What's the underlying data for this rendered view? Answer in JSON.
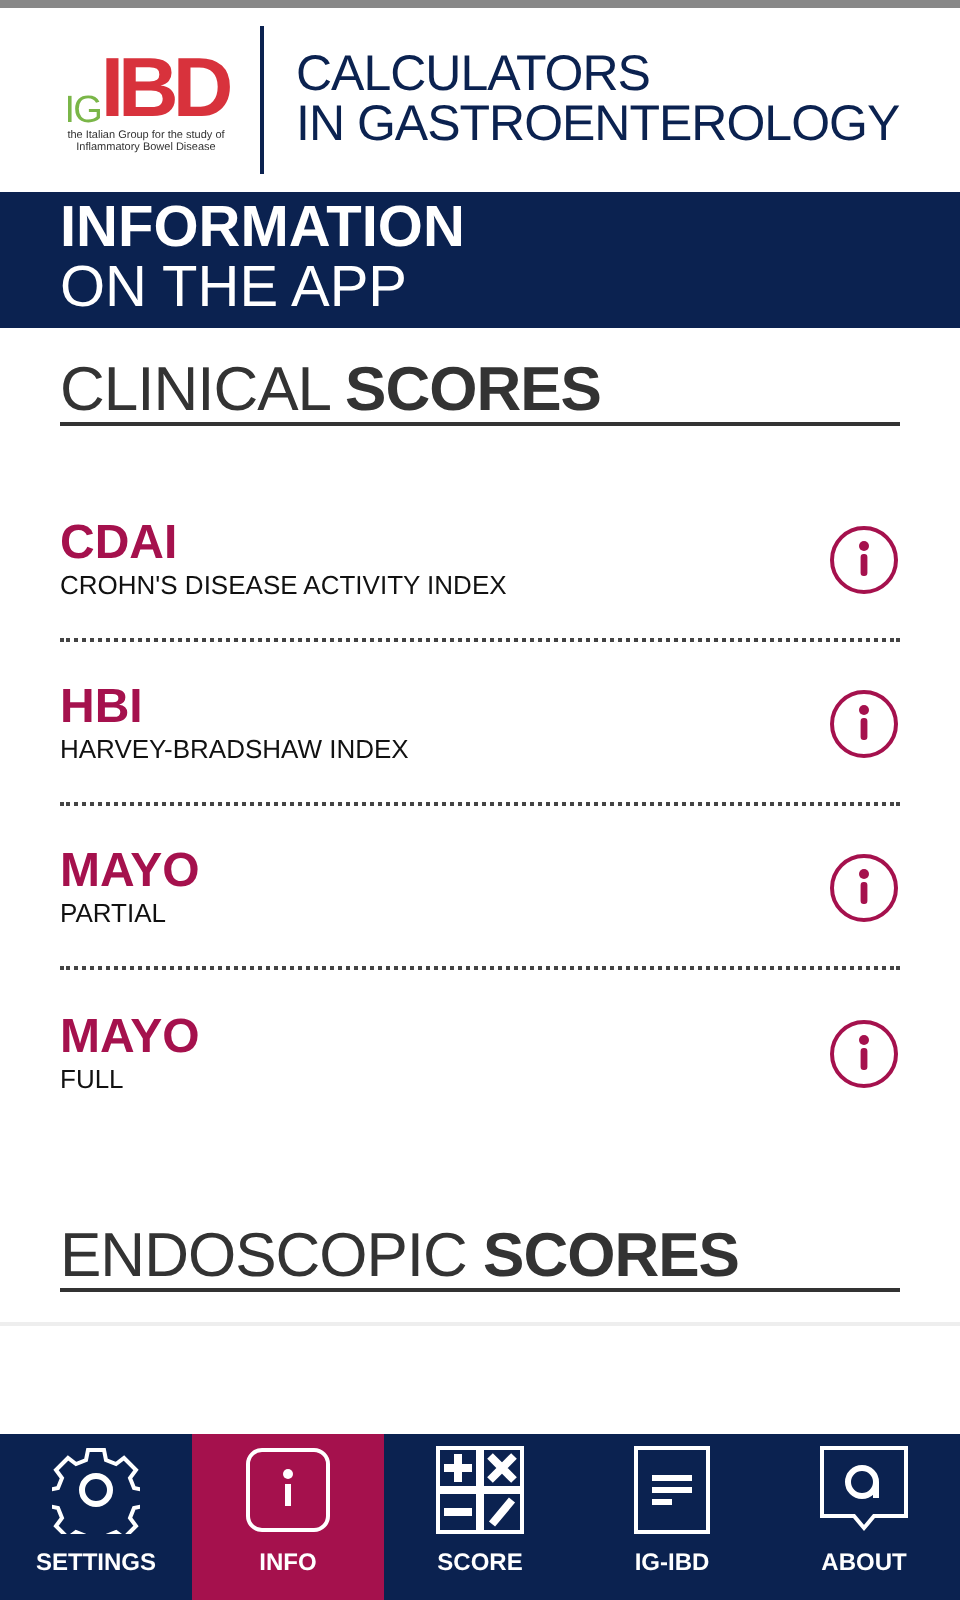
{
  "header": {
    "logo": {
      "prefix": "IG",
      "main": "IBD",
      "tagline": [
        "the Italian Group for the study of",
        "Inflammatory Bowel Disease"
      ]
    },
    "title": [
      "CALCULATORS",
      "IN GASTROENTEROLOGY"
    ]
  },
  "banner": {
    "title": "INFORMATION",
    "subtitle": "ON THE APP"
  },
  "sections": [
    {
      "heading": "CLINICAL **SCORES**",
      "items": [
        {
          "name": "CDAI",
          "description": "CROHN'S DISEASE ACTIVITY INDEX"
        },
        {
          "name": "HBI",
          "description": "HARVEY-BRADSHAW INDEX"
        },
        {
          "name": "MAYO",
          "description": "PARTIAL"
        },
        {
          "name": "MAYO",
          "description": "FULL"
        }
      ]
    },
    {
      "heading": "ENDOSCOPIC **SCORES**"
    }
  ],
  "nav": [
    {
      "kind": "settings",
      "label": "SETTINGS",
      "selected": false
    },
    {
      "kind": "info",
      "label": "INFO",
      "selected": true
    },
    {
      "kind": "score",
      "label": "SCORE",
      "selected": false
    },
    {
      "kind": "igibd",
      "label": "IG-IBD",
      "selected": false
    },
    {
      "kind": "about",
      "label": "ABOUT",
      "selected": false
    }
  ]
}
